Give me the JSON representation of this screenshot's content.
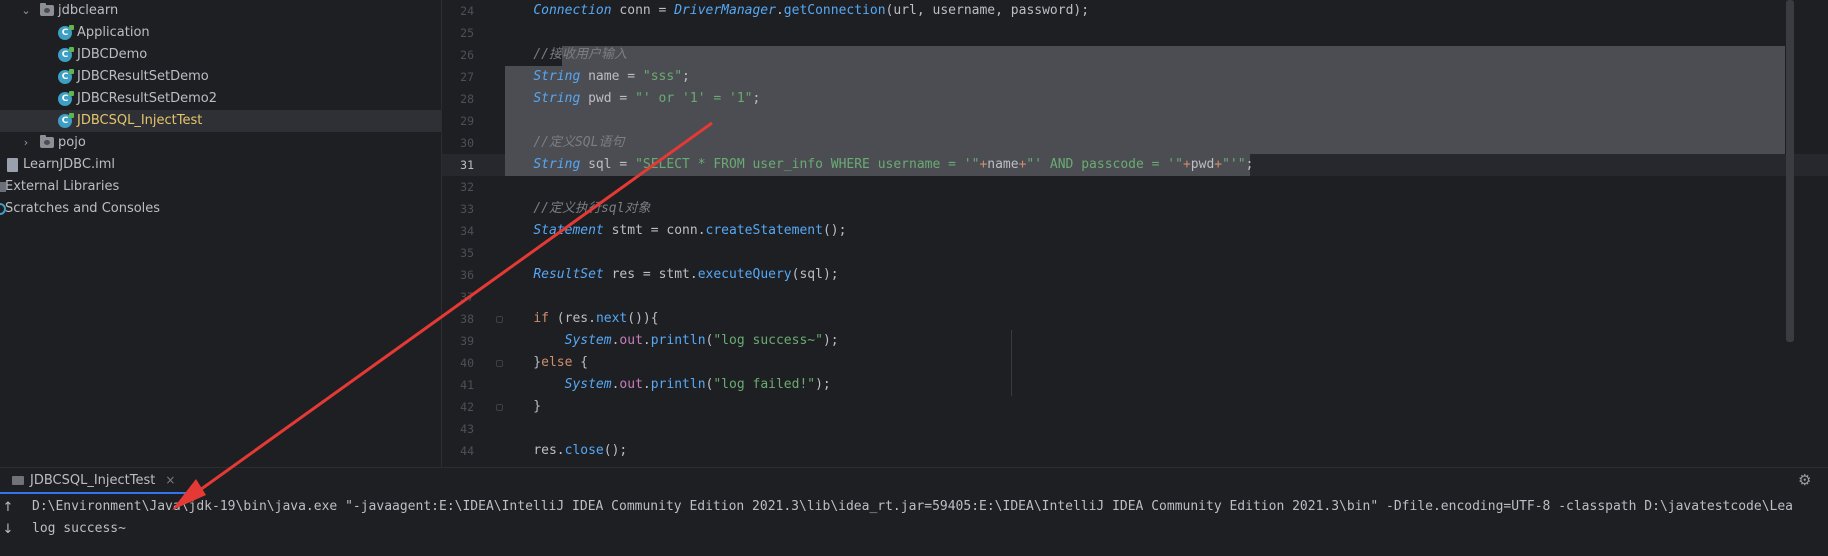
{
  "project_tree": {
    "items": [
      {
        "label": "jdbclearn",
        "kind": "package",
        "expanded": true
      },
      {
        "label": "Application",
        "kind": "class"
      },
      {
        "label": "JDBCDemo",
        "kind": "class"
      },
      {
        "label": "JDBCResultSetDemo",
        "kind": "class"
      },
      {
        "label": "JDBCResultSetDemo2",
        "kind": "class"
      },
      {
        "label": "JDBCSQL_InjectTest",
        "kind": "class",
        "selected": true
      },
      {
        "label": "pojo",
        "kind": "package",
        "expanded": false
      },
      {
        "label": "LearnJDBC.iml",
        "kind": "file"
      },
      {
        "label": "External Libraries",
        "kind": "library"
      },
      {
        "label": "Scratches and Consoles",
        "kind": "scratch"
      }
    ]
  },
  "editor": {
    "current_line": "31",
    "lines": [
      {
        "n": "24",
        "code": "Connection conn = DriverManager.getConnection(url, username, password);"
      },
      {
        "n": "25",
        "code": ""
      },
      {
        "n": "26",
        "code": "//接收用户输入"
      },
      {
        "n": "27",
        "code": "String name = \"sss\";"
      },
      {
        "n": "28",
        "code": "String pwd = \"' or '1' = '1\";"
      },
      {
        "n": "29",
        "code": ""
      },
      {
        "n": "30",
        "code": "//定义SQL语句"
      },
      {
        "n": "31",
        "code": "String sql = \"SELECT * FROM user_info WHERE username = '\"+name+\"' AND passcode = '\"+pwd+\"'\";"
      },
      {
        "n": "32",
        "code": ""
      },
      {
        "n": "33",
        "code": "//定义执行sql对象"
      },
      {
        "n": "34",
        "code": "Statement stmt = conn.createStatement();"
      },
      {
        "n": "35",
        "code": ""
      },
      {
        "n": "36",
        "code": "ResultSet res = stmt.executeQuery(sql);"
      },
      {
        "n": "37",
        "code": ""
      },
      {
        "n": "38",
        "code": "if (res.next()){"
      },
      {
        "n": "39",
        "code": "System.out.println(\"log success~\");"
      },
      {
        "n": "40",
        "code": "}else {"
      },
      {
        "n": "41",
        "code": "System.out.println(\"log failed!\");"
      },
      {
        "n": "42",
        "code": "}"
      },
      {
        "n": "43",
        "code": ""
      },
      {
        "n": "44",
        "code": "res.close();"
      }
    ]
  },
  "run_panel": {
    "tab_label": "JDBCSQL_InjectTest",
    "tab_close": "×",
    "gear": "⚙",
    "arrow_up": "↑",
    "arrow_down": "↓",
    "console": [
      "D:\\Environment\\Java\\jdk-19\\bin\\java.exe \"-javaagent:E:\\IDEA\\IntelliJ IDEA Community Edition 2021.3\\lib\\idea_rt.jar=59405:E:\\IDEA\\IntelliJ IDEA Community Edition 2021.3\\bin\" -Dfile.encoding=UTF-8 -classpath D:\\javatestcode\\Lea",
      "log success~"
    ]
  },
  "colors": {
    "background": "#1e1f22",
    "selection": "#4b4d52",
    "annotation_arrow": "#e53935",
    "selected_file": "#e6c56a"
  }
}
